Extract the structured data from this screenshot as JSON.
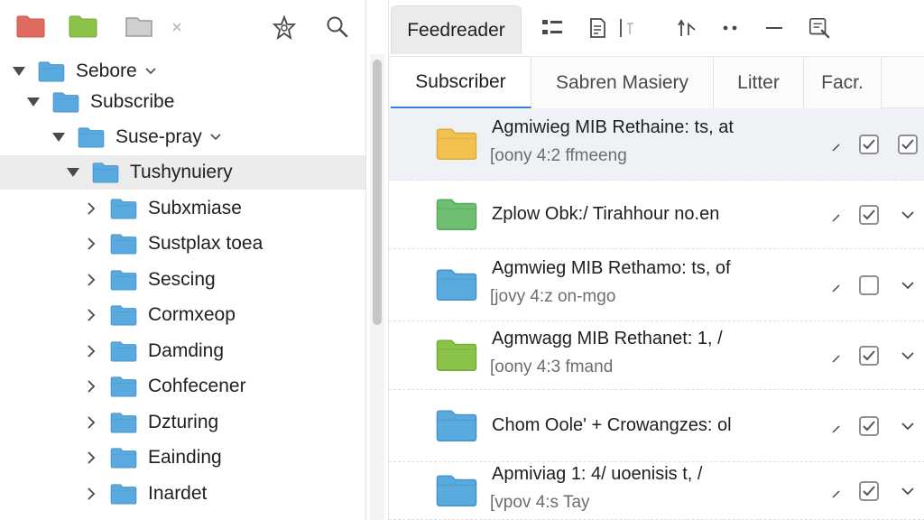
{
  "left_toolbar": {
    "icons": [
      "red-folder-icon",
      "green-folder-icon",
      "flag-icon",
      "chevron-down-icon",
      "star-settings-icon",
      "search-icon"
    ]
  },
  "tree": [
    {
      "label": "Sebore",
      "expanded": true,
      "caret": true,
      "color": "#5aa9df"
    },
    {
      "label": "Subscribe",
      "expanded": true,
      "caret": false,
      "color": "#5aa9df"
    },
    {
      "label": "Suse-pray",
      "expanded": true,
      "caret": true,
      "color": "#5aa9df"
    },
    {
      "label": "Tushynuiery",
      "expanded": true,
      "caret": false,
      "color": "#5aa9df",
      "selected": true
    },
    {
      "label": "Subxmiase",
      "expanded": false,
      "color": "#5aa9df"
    },
    {
      "label": "Sustplax toea",
      "expanded": false,
      "color": "#5aa9df"
    },
    {
      "label": "Sescing",
      "expanded": false,
      "color": "#5aa9df"
    },
    {
      "label": "Cormxeop",
      "expanded": false,
      "color": "#5aa9df"
    },
    {
      "label": "Damding",
      "expanded": false,
      "color": "#5aa9df"
    },
    {
      "label": "Cohfecener",
      "expanded": false,
      "color": "#5aa9df"
    },
    {
      "label": "Dzturing",
      "expanded": false,
      "color": "#5aa9df"
    },
    {
      "label": "Eainding",
      "expanded": false,
      "color": "#5aa9df"
    },
    {
      "label": "Inardet",
      "expanded": false,
      "color": "#5aa9df"
    }
  ],
  "right_toolbar": {
    "app_tab": "Feedreader",
    "icons": [
      "list-view-icon",
      "document-icon",
      "separator-icon",
      "move-up-icon",
      "more-icon",
      "minimize-icon",
      "edit-note-icon"
    ]
  },
  "tabs": [
    {
      "label": "Subscriber",
      "active": true
    },
    {
      "label": "Sabren Masiery",
      "active": false
    },
    {
      "label": "Litter",
      "active": false
    },
    {
      "label": "Facr.",
      "active": false
    }
  ],
  "items": [
    {
      "title": "Agmiwieg MIB Rethaine: ts, at",
      "sub": "[oony 4:2 ffmeeng",
      "folder_color": "#f2c14e",
      "checked": true,
      "trailing": "checkbox",
      "selected": true
    },
    {
      "title": "Zplow Obk:/ Tirahhour no.en",
      "sub": "",
      "folder_color": "#6fbf73",
      "checked": true,
      "trailing": "chevron"
    },
    {
      "title": "Agmwieg MIB Rethamo: ts, of",
      "sub": "[jovy 4:z on-mgo",
      "folder_color": "#5aa9df",
      "checked": false,
      "trailing": "chevron"
    },
    {
      "title": "Agmwagg MIB Rethanet: 1,  /",
      "sub": "[oony 4:3 fmand",
      "folder_color": "#8bc34a",
      "checked": true,
      "trailing": "chevron"
    },
    {
      "title": "Chom Oole' + Crowangzes: ol",
      "sub": "",
      "folder_color": "#5aa9df",
      "checked": true,
      "trailing": "chevron"
    },
    {
      "title": "Apmiviag 1: 4/ uoenisis t,  /",
      "sub": "[vpov 4:s Tay",
      "folder_color": "#5aa9df",
      "checked": true,
      "trailing": "chevron"
    }
  ]
}
